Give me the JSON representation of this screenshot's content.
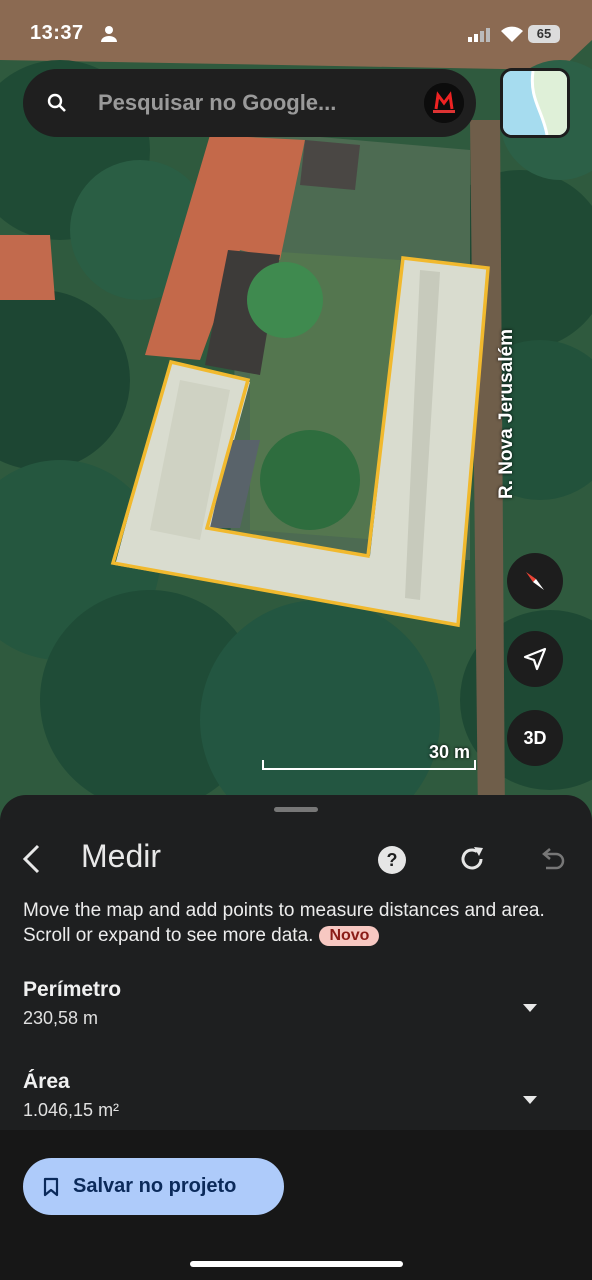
{
  "status_bar": {
    "time": "13:37",
    "battery": "65"
  },
  "search": {
    "placeholder": "Pesquisar no Google..."
  },
  "map": {
    "road_label": "R. Nova Jerusalém",
    "scale_label": "30 m",
    "three_d_label": "3D",
    "outline_color": "#f1b92e"
  },
  "measure_panel": {
    "title": "Medir",
    "description": "Move the map and add points to measure distances and area. Scroll or expand to see more data.",
    "badge": "Novo",
    "perimeter": {
      "label": "Perímetro",
      "value": "230,58 m"
    },
    "area": {
      "label": "Área",
      "value": "1.046,15 m²"
    }
  },
  "footer": {
    "save_label": "Salvar no projeto"
  },
  "icons": [
    "person-icon",
    "signal-icon",
    "wifi-icon",
    "search-icon",
    "layers-icon",
    "compass-icon",
    "navigation-icon",
    "back-icon",
    "help-icon",
    "reset-icon",
    "undo-icon",
    "caret-down-icon",
    "bookmark-icon"
  ]
}
